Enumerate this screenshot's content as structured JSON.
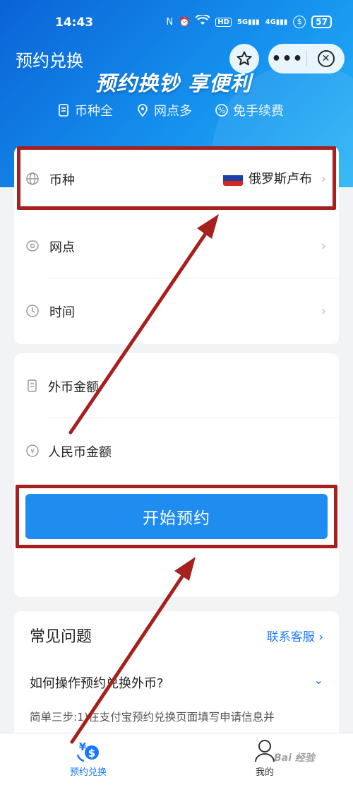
{
  "status_bar": {
    "time": "14:43",
    "icons": [
      "N",
      "⏰",
      "wifi",
      "HD",
      "5G",
      "4G",
      "$"
    ],
    "battery": "57"
  },
  "header": {
    "title": "预约兑换",
    "slogan": "预约换钞 享便利",
    "features": [
      {
        "label": "币种全",
        "icon": "card-icon"
      },
      {
        "label": "网点多",
        "icon": "location-icon"
      },
      {
        "label": "免手续费",
        "icon": "percent-icon"
      }
    ]
  },
  "form": {
    "currency_label": "币种",
    "currency_value": "俄罗斯卢布",
    "branch_label": "网点",
    "time_label": "时间",
    "foreign_amount_label": "外币金额",
    "rmb_amount_label": "人民币金额",
    "submit_label": "开始预约"
  },
  "faq": {
    "title": "常见问题",
    "contact": "联系客服",
    "question": "如何操作预约兑换外币?",
    "answer": "简单三步:1)在支付宝预约兑换页面填写申请信息并"
  },
  "bottom_nav": {
    "home_label": "预约兑换",
    "mine_label": "我的"
  },
  "watermark": "Bai 经验",
  "colors": {
    "primary": "#1f8cf0",
    "link": "#1677ff",
    "highlight": "#a5201f"
  }
}
